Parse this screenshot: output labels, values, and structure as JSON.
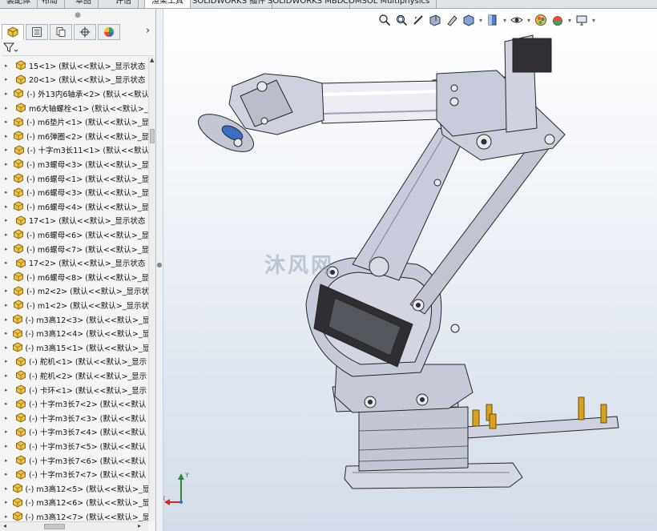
{
  "command_tabs": [
    "装配体",
    "布局",
    "草图",
    "评估",
    "渲染工具",
    "SOLIDWORKS 插件",
    "SOLIDWORKS MBD",
    "COMSOL Multiphysics"
  ],
  "active_tab": "渲染工具",
  "feature_tree": [
    {
      "label": "15<1> (默认<<默认>_显示状态"
    },
    {
      "label": "20<1> (默认<<默认>_显示状态"
    },
    {
      "label": "(-) 外13内6轴承<2> (默认<<默认"
    },
    {
      "label": "m6大轴螺栓<1> (默认<<默认>_"
    },
    {
      "label": "(-) m6垫片<1> (默认<<默认>_显"
    },
    {
      "label": "(-) m6弹圈<2> (默认<<默认>_显"
    },
    {
      "label": "(-) 十字m3长11<1> (默认<<默认"
    },
    {
      "label": "(-) m3螺母<3> (默认<<默认>_显"
    },
    {
      "label": "(-) m6螺母<1> (默认<<默认>_显"
    },
    {
      "label": "(-) m6螺母<3> (默认<<默认>_显"
    },
    {
      "label": "(-) m6螺母<4> (默认<<默认>_显"
    },
    {
      "label": "17<1> (默认<<默认>_显示状态"
    },
    {
      "label": "(-) m6螺母<6> (默认<<默认>_显"
    },
    {
      "label": "(-) m6螺母<7> (默认<<默认>_显"
    },
    {
      "label": "17<2> (默认<<默认>_显示状态"
    },
    {
      "label": "(-) m6螺母<8> (默认<<默认>_显"
    },
    {
      "label": "(-) m2<2> (默认<<默认>_显示状"
    },
    {
      "label": "(-) m1<2> (默认<<默认>_显示状"
    },
    {
      "label": "(-) m3高12<3> (默认<<默认>_显"
    },
    {
      "label": "(-) m3高12<4> (默认<<默认>_显"
    },
    {
      "label": "(-) m3高15<1> (默认<<默认>_显"
    },
    {
      "label": "(-) 舵机<1> (默认<<默认>_显示"
    },
    {
      "label": "(-) 舵机<2> (默认<<默认>_显示"
    },
    {
      "label": "(-) 卡环<1> (默认<<默认>_显示"
    },
    {
      "label": "(-) 十字m3长7<2> (默认<<默认"
    },
    {
      "label": "(-) 十字m3长7<3> (默认<<默认"
    },
    {
      "label": "(-) 十字m3长7<4> (默认<<默认"
    },
    {
      "label": "(-) 十字m3长7<5> (默认<<默认"
    },
    {
      "label": "(-) 十字m3长7<6> (默认<<默认"
    },
    {
      "label": "(-) 十字m3长7<7> (默认<<默认"
    },
    {
      "label": "(-) m3高12<5> (默认<<默认>_显"
    },
    {
      "label": "(-) m3高12<6> (默认<<默认>_显"
    },
    {
      "label": "(-) m3高12<7> (默认<<默认>_显"
    }
  ],
  "watermark": "沐风网",
  "triad": {
    "x_label": "X",
    "y_label": "Y"
  },
  "colors": {
    "part_body": "#c9ccd8",
    "part_edge": "#2a2a2a",
    "accent_blue": "#3b6fc6",
    "brass": "#d7a21f",
    "viewport_top": "#ffffff",
    "viewport_bottom": "#d3dce8"
  },
  "icons": {
    "hud": [
      "zoom-fit-icon",
      "zoom-area-icon",
      "previous-view-icon",
      "section-view-icon",
      "dynamic-annotation-icon",
      "view-orientation-icon",
      "display-style-icon",
      "hide-show-icon",
      "edit-appearance-icon",
      "apply-scene-icon",
      "view-settings-icon"
    ],
    "manager_tabs": [
      "feature-manager-icon",
      "property-manager-icon",
      "configuration-manager-icon",
      "dim-xpert-icon",
      "display-manager-icon"
    ]
  }
}
